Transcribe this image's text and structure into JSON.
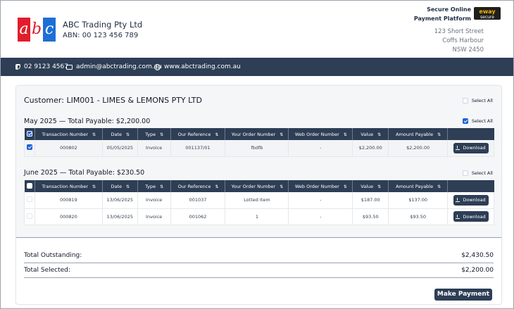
{
  "company": {
    "logo_letters": [
      "a",
      "b",
      "c"
    ],
    "name": "ABC Trading Pty Ltd",
    "abn": "ABN: 00 123 456 789",
    "secure_line1": "Secure Online",
    "secure_line2": "Payment Platform",
    "eway_brand": "eway",
    "eway_sub": "secure online",
    "address": [
      "123 Short Street",
      "Coffs Harbour",
      "NSW 2450"
    ]
  },
  "contact": {
    "phone": "02 9123 4567",
    "email": "admin@abctrading.com.au",
    "website": "www.abctrading.com.au"
  },
  "customer": {
    "title": "Customer: LIM001 - LIMES & LEMONS PTY LTD",
    "select_all": "Select All"
  },
  "columns": [
    "Transaction Number",
    "Date",
    "Type",
    "Our Reference",
    "Your Order Number",
    "Web Order Number",
    "Value",
    "Amount Payable"
  ],
  "groups": [
    {
      "title": "May 2025 — Total Payable: $2,200.00",
      "select_all": "Select All",
      "selected": true,
      "rows": [
        {
          "selected": true,
          "cells": [
            "000802",
            "05/05/2025",
            "Invoice",
            "001137/01",
            "fbdfb",
            "-",
            "$2,200.00",
            "$2,200.00"
          ],
          "action": "Download"
        }
      ]
    },
    {
      "title": "June 2025 — Total Payable: $230.50",
      "select_all": "Select All",
      "selected": false,
      "rows": [
        {
          "selected": false,
          "cells": [
            "000819",
            "13/06/2025",
            "Invoice",
            "001037",
            "Lotted Item",
            "-",
            "$187.00",
            "$137.00"
          ],
          "action": "Download"
        },
        {
          "selected": false,
          "cells": [
            "000820",
            "13/06/2025",
            "Invoice",
            "001062",
            "1",
            "-",
            "$93.50",
            "$93.50"
          ],
          "action": "Download"
        }
      ]
    }
  ],
  "totals": {
    "outstanding_label": "Total Outstanding:",
    "outstanding_value": "$2,430.50",
    "selected_label": "Total Selected:",
    "selected_value": "$2,200.00"
  },
  "make_payment": "Make Payment",
  "colors": {
    "navy": "#2d3e55",
    "accent_blue": "#1e63d4",
    "logo_red": "#e11d2b",
    "logo_blue": "#1d6fd6"
  },
  "icons": {
    "phone": "phone-icon",
    "mail": "mail-icon",
    "globe": "globe-icon",
    "sort": "sort-icon",
    "download": "download-icon",
    "checkbox": "checkbox-icon"
  }
}
